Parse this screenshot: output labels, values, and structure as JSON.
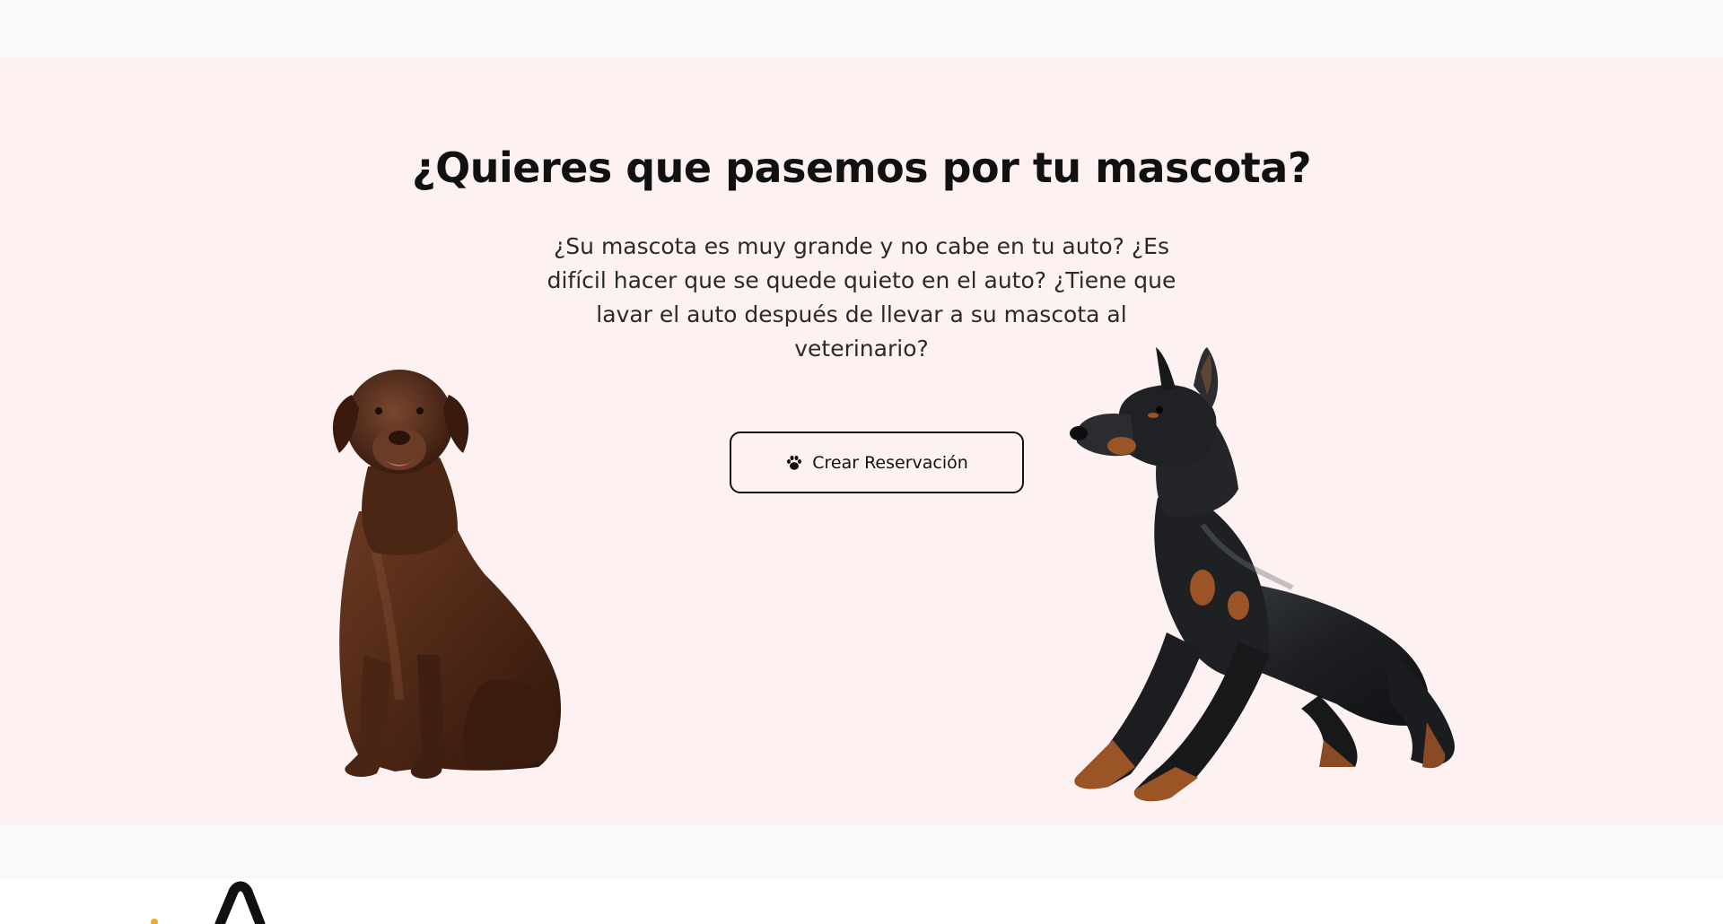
{
  "hero": {
    "title": "¿Quieres que pasemos por tu mascota?",
    "description": "¿Su mascota es muy grande y no cabe en tu auto? ¿Es difícil hacer que se quede quieto en el auto? ¿Tiene que lavar el auto después de llevar a su mascota al veterinario?",
    "cta_label": "Crear Reservación",
    "cta_icon": "paw-icon",
    "background_color": "#fdf2f1"
  },
  "images": {
    "left_dog": "chocolate-labrador-sitting",
    "right_dog": "doberman-crouching"
  },
  "colors": {
    "text": "#111111",
    "button_border": "#111111",
    "accent_orange": "#f5a623"
  }
}
